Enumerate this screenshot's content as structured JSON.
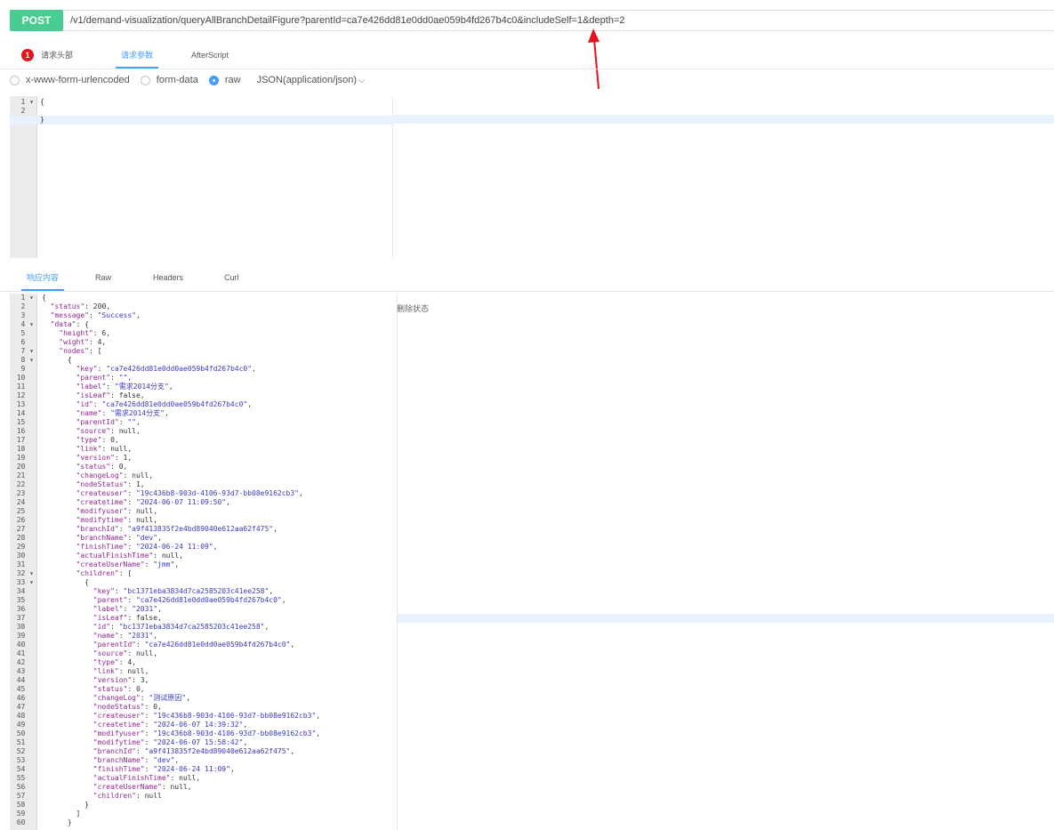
{
  "request": {
    "method": "POST",
    "url": "/v1/demand-visualization/queryAllBranchDetailFigure?parentId=ca7e426dd81e0dd0ae059b4fd267b4c0&includeSelf=1&depth=2"
  },
  "request_tabs": [
    {
      "label": "请求头部",
      "badge": "1"
    },
    {
      "label": "请求参数",
      "active": true
    },
    {
      "label": "AfterScript"
    }
  ],
  "body_type": {
    "options": [
      "x-www-form-urlencoded",
      "form-data",
      "raw"
    ],
    "selected": "raw",
    "format": "JSON(application/json)"
  },
  "request_body": {
    "lines": [
      {
        "n": "1",
        "fold": true,
        "text": "{"
      },
      {
        "n": "2",
        "text": ""
      },
      {
        "n": "3",
        "text": "}"
      }
    ]
  },
  "response_tabs": [
    {
      "label": "响应内容",
      "active": true
    },
    {
      "label": "Raw"
    },
    {
      "label": "Headers"
    },
    {
      "label": "Curl"
    }
  ],
  "side_panel": {
    "label": "删除状态"
  },
  "response_body": {
    "lines": [
      [
        "1",
        "{",
        true
      ],
      [
        "2",
        "  \"status\": 200,"
      ],
      [
        "3",
        "  \"message\": \"Success\","
      ],
      [
        "4",
        "  \"data\": {",
        true
      ],
      [
        "5",
        "    \"height\": 6,"
      ],
      [
        "6",
        "    \"wight\": 4,"
      ],
      [
        "7",
        "    \"nodes\": [",
        true
      ],
      [
        "8",
        "      {",
        true
      ],
      [
        "9",
        "        \"key\": \"ca7e426dd81e0dd0ae059b4fd267b4c0\","
      ],
      [
        "10",
        "        \"parent\": \"\","
      ],
      [
        "11",
        "        \"label\": \"需求2014分支\","
      ],
      [
        "12",
        "        \"isLeaf\": false,"
      ],
      [
        "13",
        "        \"id\": \"ca7e426dd81e0dd0ae059b4fd267b4c0\","
      ],
      [
        "14",
        "        \"name\": \"需求2014分支\","
      ],
      [
        "15",
        "        \"parentId\": \"\","
      ],
      [
        "16",
        "        \"source\": null,"
      ],
      [
        "17",
        "        \"type\": 0,"
      ],
      [
        "18",
        "        \"link\": null,"
      ],
      [
        "19",
        "        \"version\": 1,"
      ],
      [
        "20",
        "        \"status\": 0,"
      ],
      [
        "21",
        "        \"changeLog\": null,"
      ],
      [
        "22",
        "        \"nodeStatus\": 1,"
      ],
      [
        "23",
        "        \"createuser\": \"19c436b8-903d-4106-93d7-bb08e9162cb3\","
      ],
      [
        "24",
        "        \"createtime\": \"2024-06-07 11:09:50\","
      ],
      [
        "25",
        "        \"modifyuser\": null,"
      ],
      [
        "26",
        "        \"modifytime\": null,"
      ],
      [
        "27",
        "        \"branchId\": \"a9f413835f2e4bd89040e612aa62f475\","
      ],
      [
        "28",
        "        \"branchName\": \"dev\","
      ],
      [
        "29",
        "        \"finishTime\": \"2024-06-24 11:09\","
      ],
      [
        "30",
        "        \"actualFinishTime\": null,"
      ],
      [
        "31",
        "        \"createUserName\": \"jmm\","
      ],
      [
        "32",
        "        \"children\": [",
        true
      ],
      [
        "33",
        "          {",
        true
      ],
      [
        "34",
        "            \"key\": \"bc1371eba3834d7ca2585203c41ee258\","
      ],
      [
        "35",
        "            \"parent\": \"ca7e426dd81e0dd0ae059b4fd267b4c0\","
      ],
      [
        "36",
        "            \"label\": \"2031\","
      ],
      [
        "37",
        "            \"isLeaf\": false,"
      ],
      [
        "38",
        "            \"id\": \"bc1371eba3834d7ca2585203c41ee258\","
      ],
      [
        "39",
        "            \"name\": \"2031\","
      ],
      [
        "40",
        "            \"parentId\": \"ca7e426dd81e0dd0ae059b4fd267b4c0\","
      ],
      [
        "41",
        "            \"source\": null,"
      ],
      [
        "42",
        "            \"type\": 4,"
      ],
      [
        "43",
        "            \"link\": null,"
      ],
      [
        "44",
        "            \"version\": 3,"
      ],
      [
        "45",
        "            \"status\": 0,"
      ],
      [
        "46",
        "            \"changeLog\": \"测试原因\","
      ],
      [
        "47",
        "            \"nodeStatus\": 0,"
      ],
      [
        "48",
        "            \"createuser\": \"19c436b8-903d-4106-93d7-bb08e9162cb3\","
      ],
      [
        "49",
        "            \"createtime\": \"2024-06-07 14:39:32\","
      ],
      [
        "50",
        "            \"modifyuser\": \"19c436b8-903d-4106-93d7-bb08e9162cb3\","
      ],
      [
        "51",
        "            \"modifytime\": \"2024-06-07 15:58:42\","
      ],
      [
        "52",
        "            \"branchId\": \"a9f413835f2e4bd89040e612aa62f475\","
      ],
      [
        "53",
        "            \"branchName\": \"dev\","
      ],
      [
        "54",
        "            \"finishTime\": \"2024-06-24 11:09\","
      ],
      [
        "55",
        "            \"actualFinishTime\": null,"
      ],
      [
        "56",
        "            \"createUserName\": null,"
      ],
      [
        "57",
        "            \"children\": null"
      ],
      [
        "58",
        "          }"
      ],
      [
        "59",
        "        ]"
      ],
      [
        "60",
        "      }"
      ]
    ],
    "highlighted_line": "37"
  },
  "colors": {
    "accent": "#409eff",
    "post": "#49cc90",
    "badge": "#e4131d",
    "arrow": "#e4131d"
  }
}
